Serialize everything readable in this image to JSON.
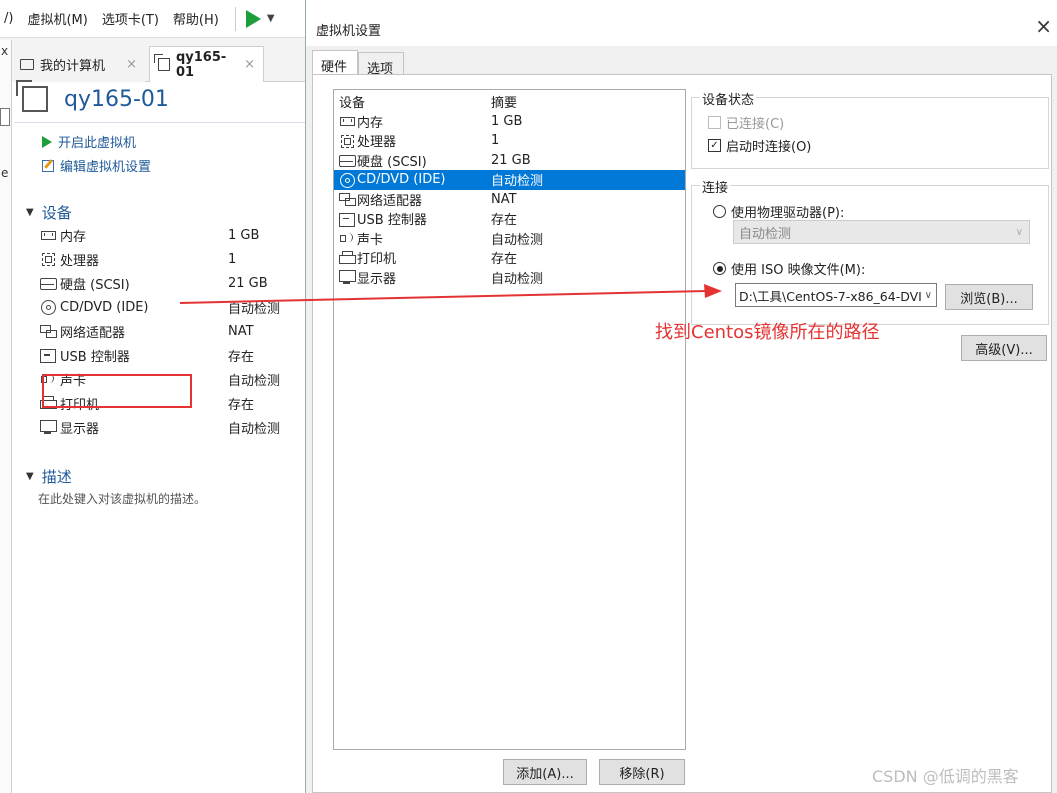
{
  "menu": {
    "cut_char": "/)",
    "items": [
      "虚拟机(M)",
      "选项卡(T)",
      "帮助(H)"
    ]
  },
  "left_edge": {
    "chars": [
      "x",
      "e"
    ]
  },
  "tabs": [
    {
      "label": "我的计算机",
      "close": "×"
    },
    {
      "label": "qy165-01",
      "close": "×"
    }
  ],
  "vm": {
    "name": "qy165-01",
    "actions": [
      "开启此虚拟机",
      "编辑虚拟机设置"
    ],
    "devices_header": "设备",
    "devices": [
      {
        "name": "内存",
        "value": "1 GB",
        "icon": "memory-icon"
      },
      {
        "name": "处理器",
        "value": "1",
        "icon": "cpu-icon"
      },
      {
        "name": "硬盘 (SCSI)",
        "value": "21 GB",
        "icon": "hard-disk-icon"
      },
      {
        "name": "CD/DVD (IDE)",
        "value": "自动检测",
        "icon": "cd-dvd-icon"
      },
      {
        "name": "网络适配器",
        "value": "NAT",
        "icon": "network-adapter-icon"
      },
      {
        "name": "USB 控制器",
        "value": "存在",
        "icon": "usb-icon"
      },
      {
        "name": "声卡",
        "value": "自动检测",
        "icon": "sound-card-icon"
      },
      {
        "name": "打印机",
        "value": "存在",
        "icon": "printer-icon"
      },
      {
        "name": "显示器",
        "value": "自动检测",
        "icon": "monitor-icon"
      }
    ],
    "desc_header": "描述",
    "desc_text": "在此处键入对该虚拟机的描述。"
  },
  "dialog": {
    "title": "虚拟机设置",
    "close": "×",
    "tabs": [
      "硬件",
      "选项"
    ],
    "list_headers": [
      "设备",
      "摘要"
    ],
    "devices": [
      {
        "name": "内存",
        "summary": "1 GB",
        "icon": "memory-icon"
      },
      {
        "name": "处理器",
        "summary": "1",
        "icon": "cpu-icon"
      },
      {
        "name": "硬盘 (SCSI)",
        "summary": "21 GB",
        "icon": "hard-disk-icon"
      },
      {
        "name": "CD/DVD (IDE)",
        "summary": "自动检测",
        "icon": "cd-dvd-icon",
        "selected": true
      },
      {
        "name": "网络适配器",
        "summary": "NAT",
        "icon": "network-adapter-icon"
      },
      {
        "name": "USB 控制器",
        "summary": "存在",
        "icon": "usb-icon"
      },
      {
        "name": "声卡",
        "summary": "自动检测",
        "icon": "sound-card-icon"
      },
      {
        "name": "打印机",
        "summary": "存在",
        "icon": "printer-icon"
      },
      {
        "name": "显示器",
        "summary": "自动检测",
        "icon": "monitor-icon"
      }
    ],
    "add_button": "添加(A)...",
    "remove_button": "移除(R)",
    "status_group": "设备状态",
    "connected": {
      "label": "已连接(C)",
      "checked": false,
      "disabled": true
    },
    "connect_on_start": {
      "label": "启动时连接(O)",
      "checked": true
    },
    "conn_group": "连接",
    "physical": {
      "label": "使用物理驱动器(P):",
      "selected": false
    },
    "physical_value": "自动检测",
    "iso": {
      "label": "使用 ISO 映像文件(M):",
      "selected": true
    },
    "iso_path": "D:\\工具\\CentOS-7-x86_64-DVI",
    "browse_button": "浏览(B)...",
    "advanced_button": "高级(V)...",
    "check_mark": "✓"
  },
  "annotation": {
    "text": "找到Centos镜像所在的路径",
    "color": "#e53333"
  },
  "watermark": "CSDN @低调的黑客",
  "colors": {
    "selection": "#0078d7",
    "link": "#1f5a99",
    "play": "#1e9e3a"
  }
}
